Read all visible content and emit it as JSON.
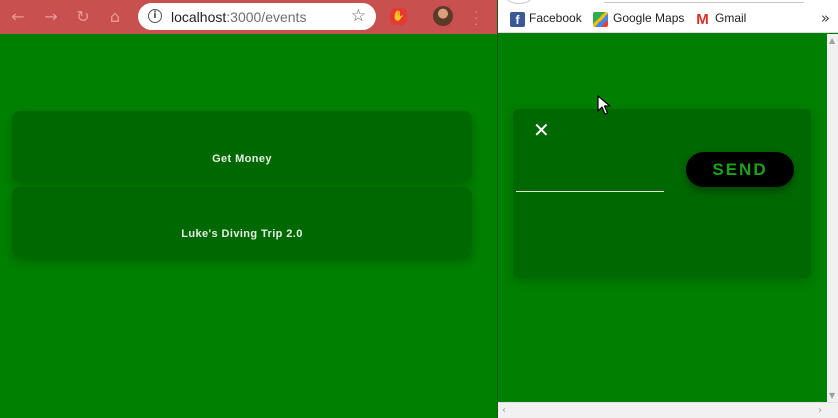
{
  "left_window": {
    "chrome": {
      "back_icon": "arrow-left-icon",
      "forward_icon": "arrow-right-icon",
      "reload_icon": "reload-icon",
      "home_icon": "home-icon",
      "url_host": "localhost",
      "url_rest": ":3000/events"
    },
    "events": [
      {
        "title": "Get Money"
      },
      {
        "title": "Luke's Diving Trip 2.0"
      }
    ]
  },
  "right_window": {
    "bookmarks": [
      {
        "label": "Facebook"
      },
      {
        "label": "Google Maps"
      },
      {
        "label": "Gmail"
      }
    ],
    "modal": {
      "close_symbol": "✕",
      "input_value": "",
      "send_label": "SEND"
    }
  },
  "colors": {
    "page_green": "#008000",
    "card_green": "#006800",
    "chrome_red": "#c8504f",
    "send_text": "#1aa31a"
  }
}
